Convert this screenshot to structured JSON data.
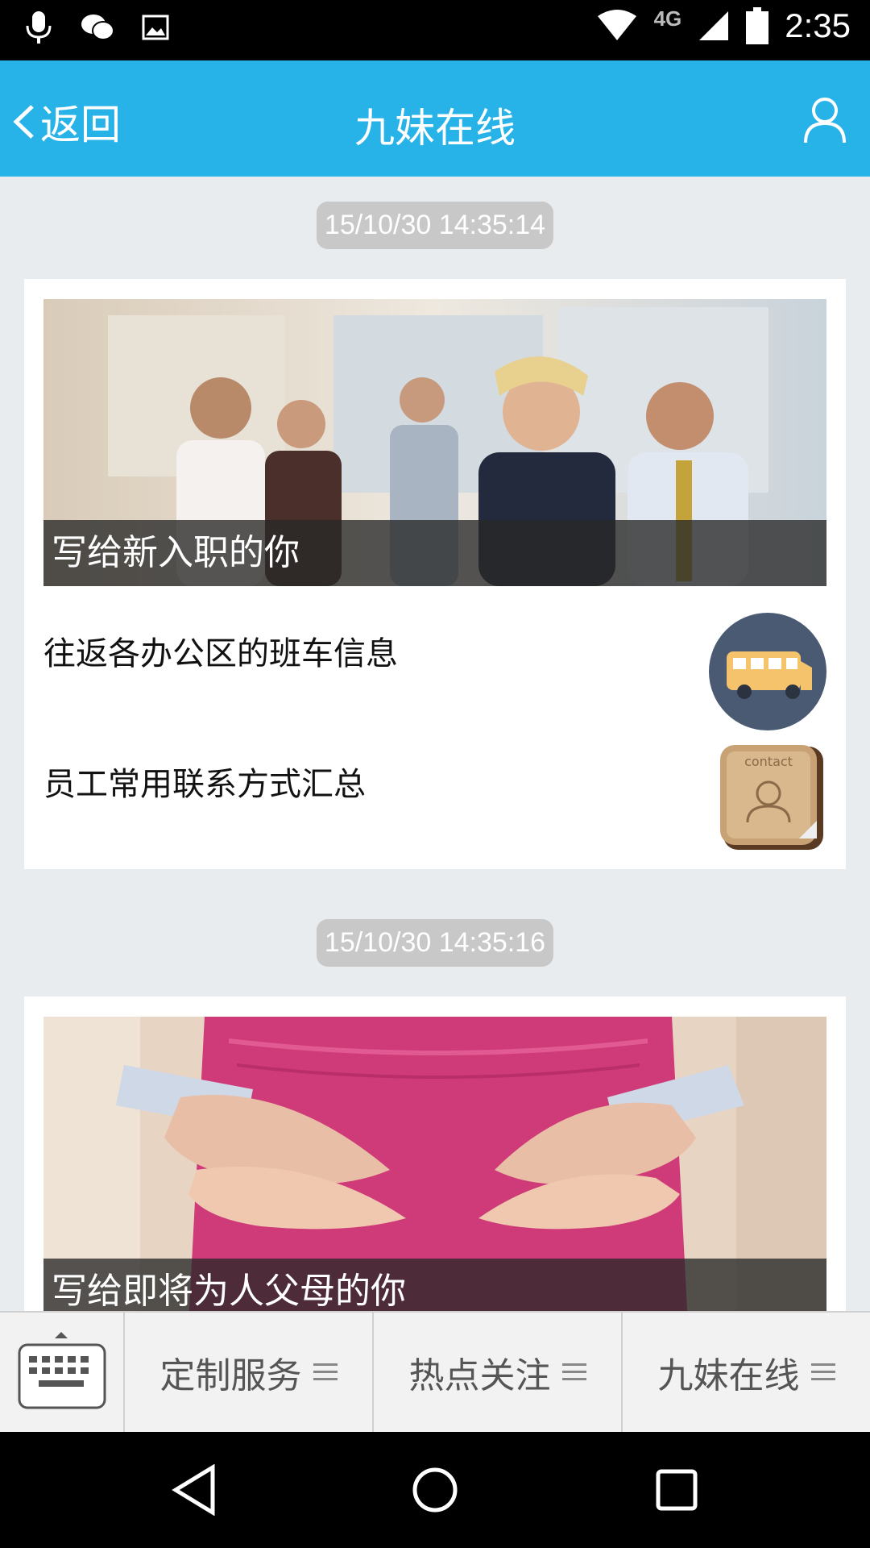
{
  "status_bar": {
    "network_label": "4G",
    "time": "2:35"
  },
  "header": {
    "back_label": "返回",
    "title": "九妹在线"
  },
  "messages": [
    {
      "timestamp": "15/10/30 14:35:14",
      "hero_caption": "写给新入职的你",
      "items": [
        {
          "title": "往返各办公区的班车信息",
          "thumb_icon": "bus-icon"
        },
        {
          "title": "员工常用联系方式汇总",
          "thumb_icon": "contact-book-icon",
          "thumb_text": "contact"
        }
      ]
    },
    {
      "timestamp": "15/10/30 14:35:16",
      "hero_caption": "写给即将为人父母的你"
    }
  ],
  "bottom_menu": {
    "tabs": [
      {
        "label": "定制服务"
      },
      {
        "label": "热点关注"
      },
      {
        "label": "九妹在线"
      }
    ]
  },
  "colors": {
    "header_bg": "#27b2e8",
    "page_bg": "#e9ecef"
  }
}
